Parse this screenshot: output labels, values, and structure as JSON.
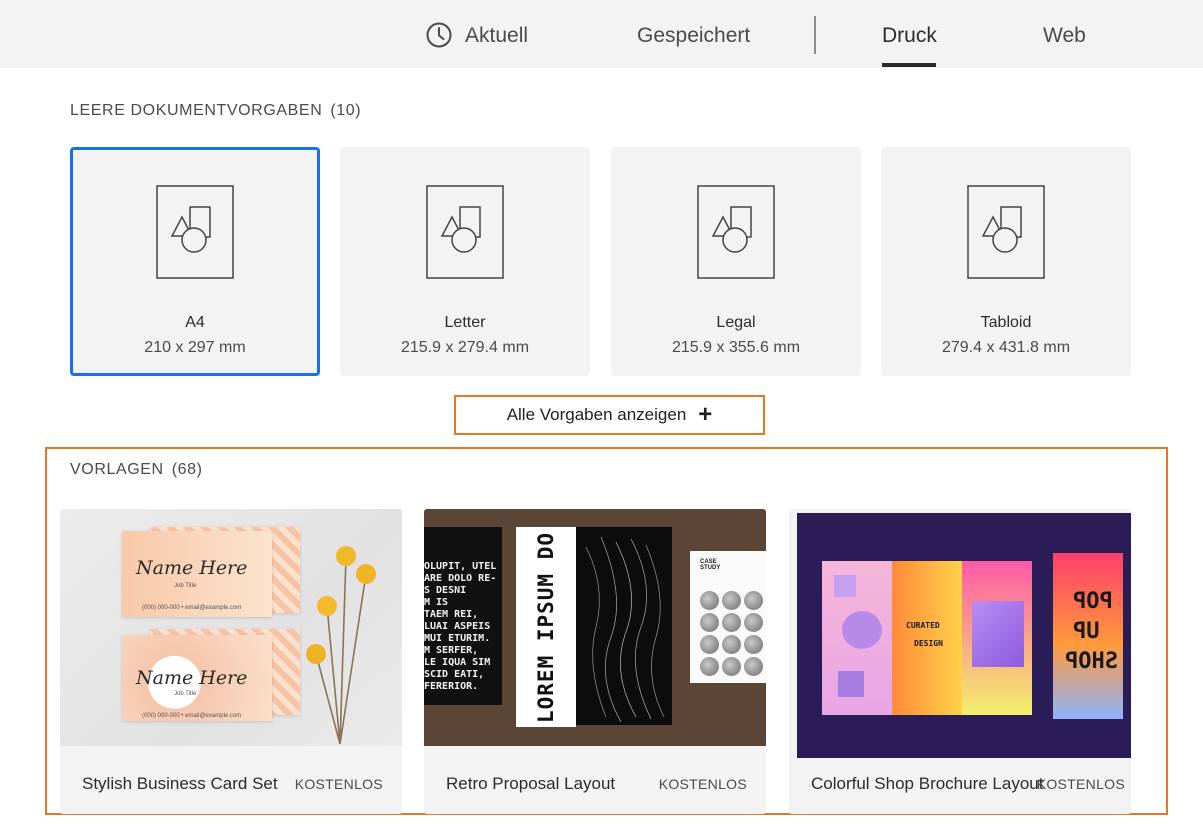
{
  "tabs": [
    {
      "label": "Aktuell",
      "icon": "clock-icon"
    },
    {
      "label": "Gespeichert"
    },
    {
      "label": "Druck",
      "active": true
    },
    {
      "label": "Web"
    }
  ],
  "presets_section": {
    "title": "LEERE DOKUMENTVORGABEN",
    "count": "(10)",
    "items": [
      {
        "name": "A4",
        "size": "210 x 297 mm",
        "selected": true,
        "icon": "document-shapes-icon"
      },
      {
        "name": "Letter",
        "size": "215.9 x 279.4 mm",
        "icon": "document-shapes-icon"
      },
      {
        "name": "Legal",
        "size": "215.9 x 355.6 mm",
        "icon": "document-shapes-icon"
      },
      {
        "name": "Tabloid",
        "size": "279.4 x 431.8 mm",
        "icon": "document-shapes-icon"
      }
    ]
  },
  "show_all_label": "Alle Vorgaben anzeigen",
  "show_all_icon": "plus-icon",
  "templates_section": {
    "title": "VORLAGEN",
    "count": "(68)",
    "items": [
      {
        "name": "Stylish Business Card Set",
        "badge": "KOSTENLOS",
        "thumb_text": {
          "script": "Name Here",
          "subtitle": "Job Title",
          "contact": "(000) 000-000 • email@example.com"
        }
      },
      {
        "name": "Retro Proposal Layout",
        "badge": "KOSTENLOS",
        "thumb_text": {
          "body_lines": [
            "OLUPIT, UTEL",
            "ARE DOLO RE-",
            "S DESNI",
            "M IS",
            "TAEM REI,",
            "LUAI ASPEIS",
            "MUI ETURIM.",
            "M SERFER,",
            "LE IQUA SIM",
            "SCID EATI,",
            "FERERIOR."
          ],
          "vertical": "LOREM IPSUM DO",
          "case_study": "CASE STUDY"
        }
      },
      {
        "name": "Colorful Shop Brochure Layout",
        "badge": "KOSTENLOS",
        "thumb_text": {
          "curated": "CURATED",
          "design": "DESIGN",
          "pop": "POP",
          "up": "UP",
          "shop": "SHOP"
        }
      }
    ]
  },
  "colors": {
    "selected_border": "#1473e6",
    "highlight_border": "#e87722",
    "card_bg": "#f3f3f3"
  }
}
